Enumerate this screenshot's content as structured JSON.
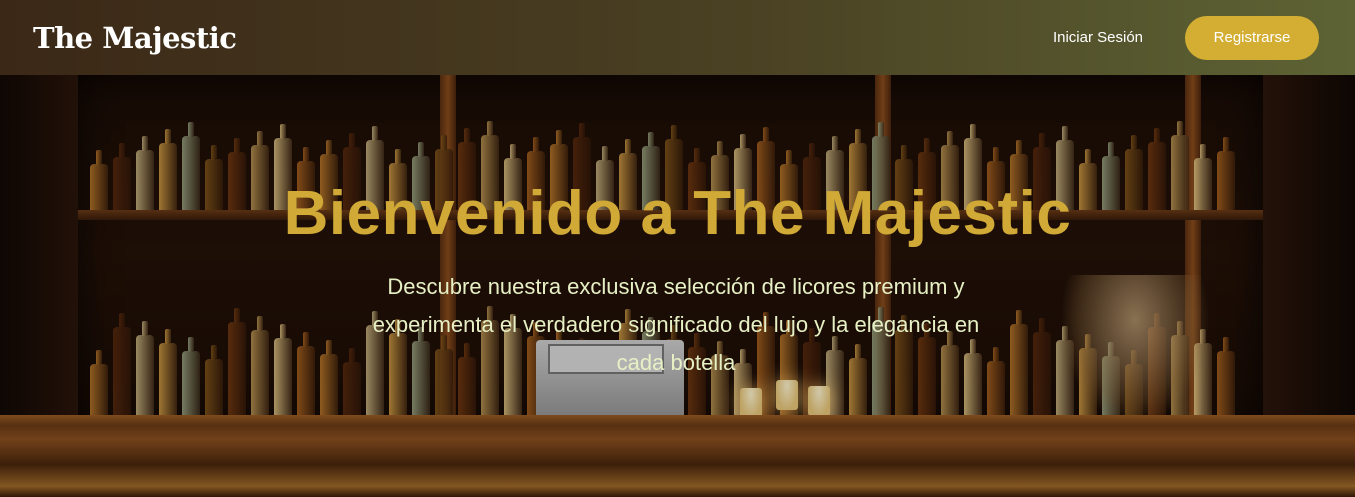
{
  "navbar": {
    "brand": "The Majestic",
    "login_label": "Iniciar Sesión",
    "register_label": "Registrarse"
  },
  "hero": {
    "title": "Bienvenido a The Majestic",
    "subtitle": "Descubre nuestra exclusiva selección de licores premium y experimenta el verdadero significado del lujo y la elegancia en cada botella",
    "background": "bar-with-liquor-shelves-image"
  },
  "colors": {
    "accent": "#d4ae33",
    "title": "#d0a936",
    "subtitle": "#e7f0c5",
    "nav_left": "#3b2817",
    "nav_right": "#5d6334"
  }
}
